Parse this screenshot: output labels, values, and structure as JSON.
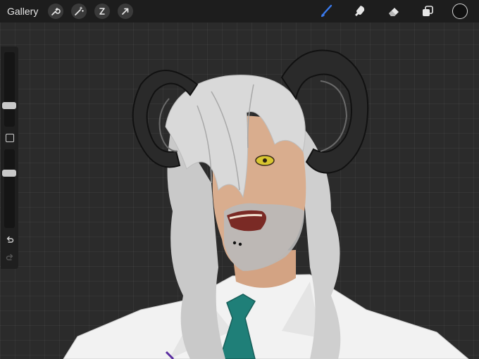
{
  "topbar": {
    "gallery_label": "Gallery",
    "left_tools": [
      "wrench-icon",
      "magic-wand-icon",
      "selection-icon",
      "transform-arrow-icon"
    ],
    "right_tools": [
      "brush-icon",
      "smudge-icon",
      "eraser-icon",
      "layers-icon"
    ],
    "active_tool": "brush-icon",
    "active_tool_color": "#3a7bf0",
    "current_color": "#111111"
  },
  "sidebar": {
    "brush_size": 0.26,
    "opacity": 0.72
  },
  "artwork": {
    "colors": {
      "hair": "#d9d9d9",
      "horns": "#2a2a2a",
      "skin": "#d9ad8e",
      "tie": "#1f7f78",
      "shirt": "#f2f2f2",
      "eye": "#d8c530"
    }
  }
}
